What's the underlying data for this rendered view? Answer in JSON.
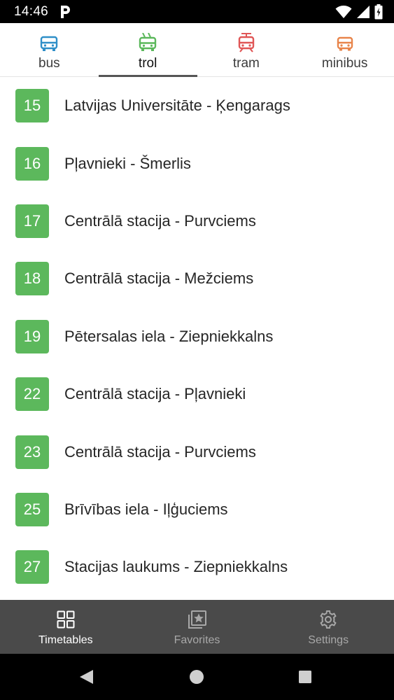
{
  "status_bar": {
    "time": "14:46"
  },
  "colors": {
    "bus": "#2f8fc8",
    "trol": "#5cb85c",
    "tram": "#e05656",
    "minibus": "#e8844a",
    "route_badge": "#5cb85c",
    "bottom_nav_bg": "#4a4a4a"
  },
  "tabs": [
    {
      "label": "bus",
      "icon": "bus-icon",
      "active": false
    },
    {
      "label": "trol",
      "icon": "trolleybus-icon",
      "active": true
    },
    {
      "label": "tram",
      "icon": "tram-icon",
      "active": false
    },
    {
      "label": "minibus",
      "icon": "minibus-icon",
      "active": false
    }
  ],
  "routes": [
    {
      "number": "15",
      "name": "Latvijas Universitāte - Ķengarags"
    },
    {
      "number": "16",
      "name": "Pļavnieki - Šmerlis"
    },
    {
      "number": "17",
      "name": "Centrālā stacija - Purvciems"
    },
    {
      "number": "18",
      "name": "Centrālā stacija - Mežciems"
    },
    {
      "number": "19",
      "name": "Pētersalas iela - Ziepniekkalns"
    },
    {
      "number": "22",
      "name": "Centrālā stacija - Pļavnieki"
    },
    {
      "number": "23",
      "name": "Centrālā stacija - Purvciems"
    },
    {
      "number": "25",
      "name": "Brīvības iela - Iļģuciems"
    },
    {
      "number": "27",
      "name": "Stacijas laukums - Ziepniekkalns"
    }
  ],
  "bottom_nav": [
    {
      "label": "Timetables",
      "icon": "grid-icon",
      "active": true
    },
    {
      "label": "Favorites",
      "icon": "star-album-icon",
      "active": false
    },
    {
      "label": "Settings",
      "icon": "gear-icon",
      "active": false
    }
  ]
}
